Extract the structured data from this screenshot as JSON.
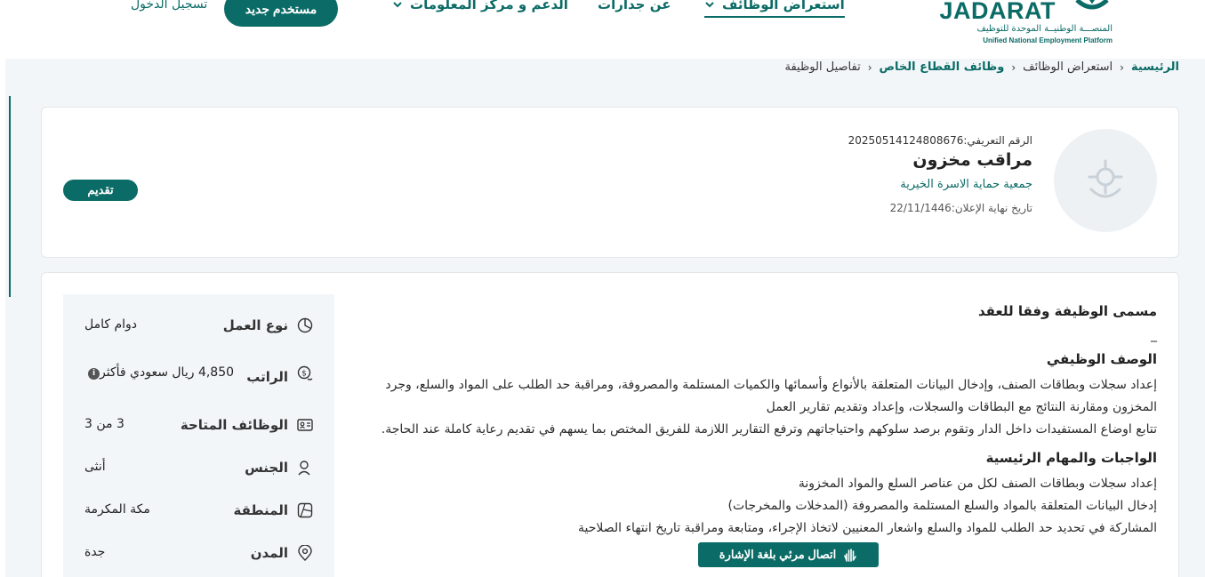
{
  "header": {
    "logo": {
      "word": "JADARAT",
      "tagline_ar": "المنصـــة الوطنيــة الموحدة للتوظيف",
      "tagline_en": "Unified National Employment Platform"
    },
    "nav": [
      {
        "label": "استعراض الوظائف",
        "active": true,
        "has_dropdown": true
      },
      {
        "label": "عن جدارات",
        "active": false,
        "has_dropdown": false
      },
      {
        "label": "الدعم و مركز المعلومات",
        "active": false,
        "has_dropdown": true
      }
    ],
    "new_user_label": "مستخدم جديد",
    "login_label": "تسجيل الدخول"
  },
  "breadcrumb": [
    "الرئيسية",
    "استعراض الوظائف",
    "وظائف القطاع الخاص",
    "تفاصيل الوظيفة"
  ],
  "job": {
    "ref_label": "الرقم التعريفي:",
    "ref_value": "20250514124808676",
    "title": "مراقب مخزون",
    "organization": "جمعية حماية الاسرة الخيرية",
    "deadline_label": "تاريخ نهاية الإعلان:",
    "deadline_value": "22/11/1446",
    "apply_label": "تقديم"
  },
  "info": [
    {
      "label": "نوع العمل",
      "value": "دوام كامل",
      "icon": "pie-chart-icon"
    },
    {
      "label": "الراتب",
      "value": "4,850 ريال سعودي فأكثر",
      "icon": "money-icon",
      "badge": "i"
    },
    {
      "label": "الوظائف المتاحة",
      "value": "3 من 3",
      "icon": "id-card-icon"
    },
    {
      "label": "الجنس",
      "value": "أنثى",
      "icon": "gender-icon"
    },
    {
      "label": "المنطقة",
      "value": "مكة المكرمة",
      "icon": "map-region-icon"
    },
    {
      "label": "المدن",
      "value": "جدة",
      "icon": "location-pin-icon"
    }
  ],
  "description": {
    "contract_title_heading": "مسمى الوظيفة وفقا للعقد",
    "contract_title_value": "_",
    "job_desc_heading": "الوصف الوظيفي",
    "job_desc_p1": "إعداد سجلات وبطاقات الصنف، وإدخال البيانات المتعلقة بالأنواع وأسمائها والكميات المستلمة والمصروفة، ومراقبة حد الطلب على المواد والسلع، وجرد المخزون ومقارنة النتائج مع البطاقات والسجلات، وإعداد وتقديم تقارير العمل",
    "job_desc_p2": "تتابع اوضاع المستفيدات داخل الدار وتقوم برصد سلوكهم واحتياجاتهم وترفع التقارير اللازمة للفريق المختص بما يسهم في تقديم رعاية كاملة عند الحاجة.",
    "duties_heading": "الواجبات والمهام الرئيسية",
    "duties": [
      "إعداد سجلات وبطاقات الصنف لكل من عناصر السلع والمواد المخزونة",
      "إدخال البيانات المتعلقة بالمواد والسلع المستلمة والمصروفة (المدخلات والمخرجات)",
      "المشاركة في تحديد حد الطلب للمواد والسلع واشعار المعنيين لاتخاذ الإجراء، ومتابعة ومراقبة تاريخ انتهاء الصلاحية"
    ]
  },
  "sign_language_label": "اتصال مرئي بلغة الإشارة",
  "colors": {
    "primary": "#0b6b66",
    "background": "#f3f6f8"
  }
}
